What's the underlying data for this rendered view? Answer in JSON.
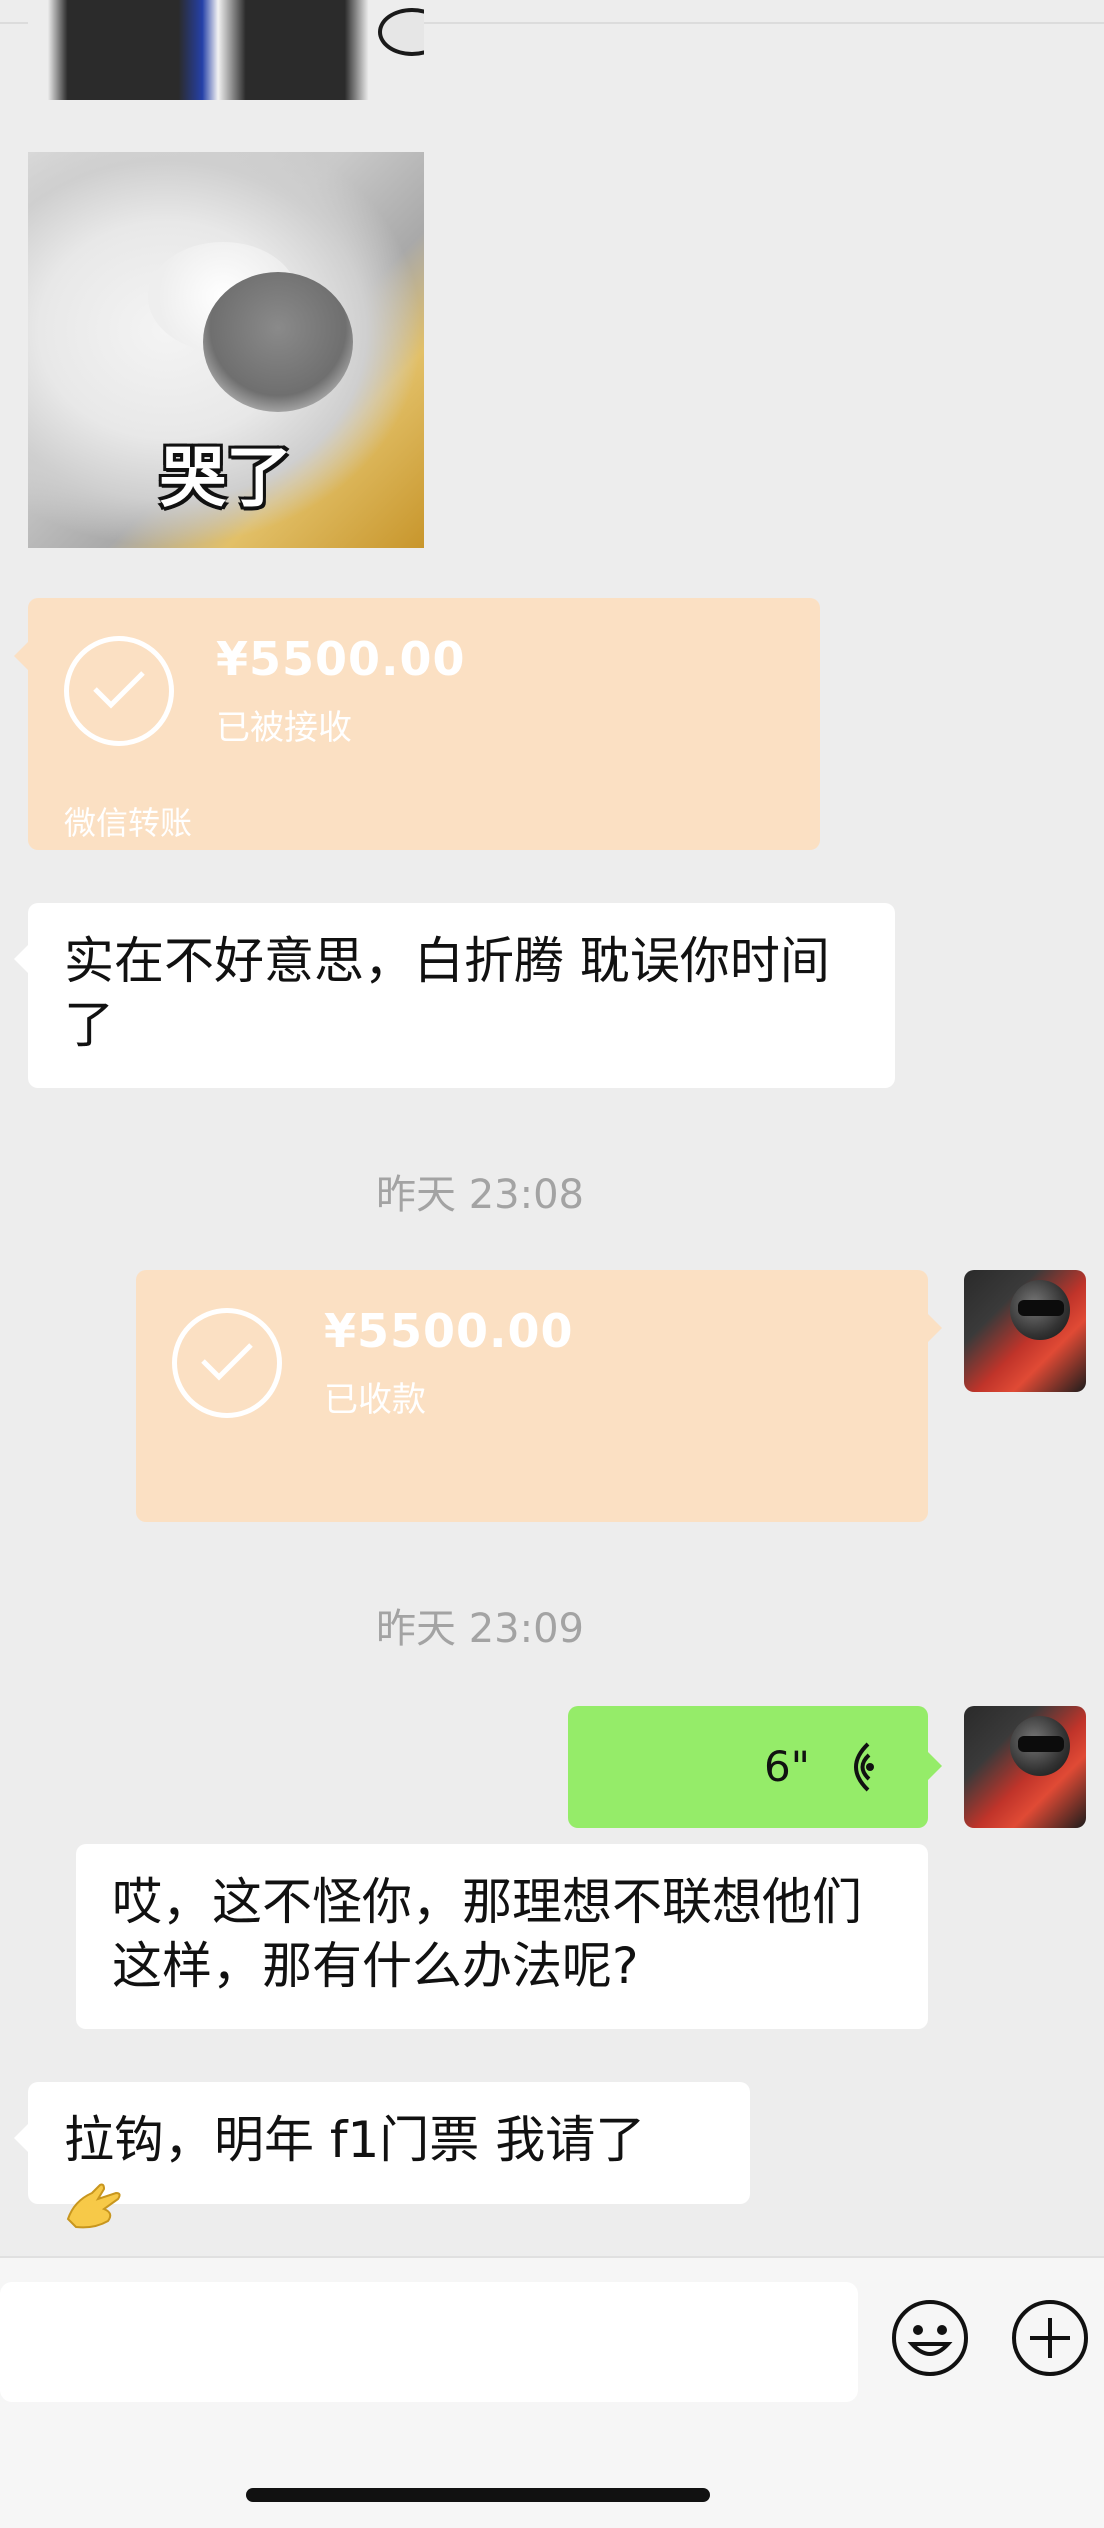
{
  "messages": {
    "sticker_caption": "哭了",
    "transfer_in": {
      "amount": "¥5500.00",
      "status": "已被接收",
      "footer": "微信转账"
    },
    "text1": "实在不好意思，白折腾 耽误你时间了",
    "timestamp1": "昨天 23:08",
    "transfer_out": {
      "amount": "¥5500.00",
      "status": "已收款"
    },
    "timestamp2": "昨天 23:09",
    "voice": {
      "duration": "6\""
    },
    "text2": "哎，这不怪你，那理想不联想他们这样，那有什么办法呢?",
    "text3": "拉钩，明年 f1门票 我请了"
  },
  "colors": {
    "background": "#ededed",
    "transfer_card": "#fbe0c3",
    "voice_bubble": "#95ec69",
    "text_bubble": "#ffffff",
    "timestamp": "#a3a3a3"
  },
  "icons": {
    "check": "check-circle-icon",
    "voice": "voice-wave-icon",
    "emoji": "smiley-face-icon",
    "plus": "plus-circle-icon",
    "hand_emoji": "pinched-hand-emoji"
  }
}
